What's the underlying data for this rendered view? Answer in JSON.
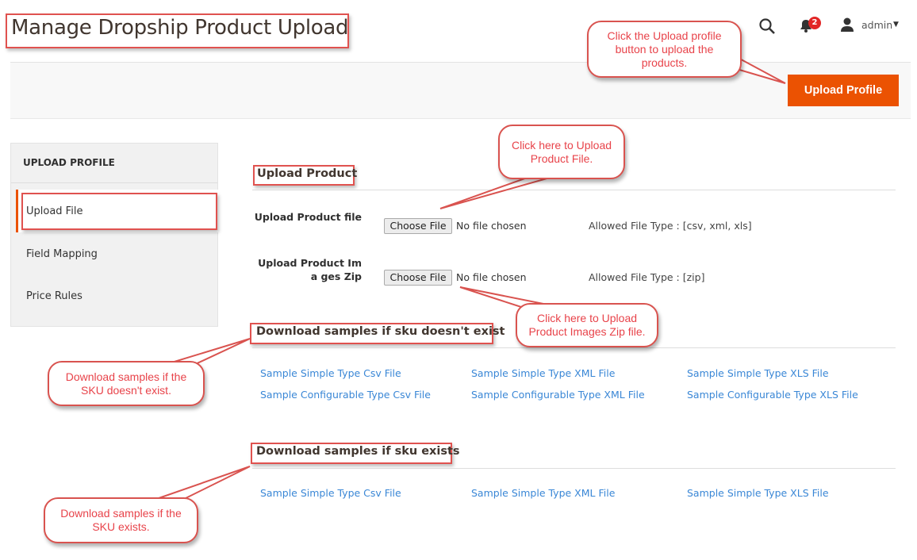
{
  "header": {
    "title": "Manage Dropship Product Upload",
    "notification_count": "2",
    "user": "admin",
    "icons": [
      "search-icon",
      "bell-icon",
      "user-icon",
      "caret-down-icon"
    ]
  },
  "toolbar": {
    "upload_profile_label": "Upload Profile",
    "accent": "#eb5202"
  },
  "sidebar": {
    "title": "UPLOAD PROFILE",
    "items": [
      {
        "label": "Upload File",
        "active": true
      },
      {
        "label": "Field Mapping"
      },
      {
        "label": "Price Rules"
      }
    ]
  },
  "upload": {
    "heading": "Upload Product",
    "rows": [
      {
        "label": "Upload Product file",
        "button": "Choose File",
        "status": "No file chosen",
        "allowed": "Allowed File Type : [csv, xml, xls]"
      },
      {
        "label": "Upload Product Ima ges Zip",
        "button": "Choose File",
        "status": "No file chosen",
        "allowed": "Allowed File Type : [zip]"
      }
    ]
  },
  "samples_not_exist": {
    "heading": "Download samples if sku doesn't exist",
    "links": [
      "Sample Simple Type Csv File",
      "Sample Simple Type XML File",
      "Sample Simple Type XLS File",
      "Sample Configurable Type Csv File",
      "Sample Configurable Type XML File",
      "Sample Configurable Type XLS File"
    ]
  },
  "samples_exist": {
    "heading": "Download samples if sku exists",
    "links": [
      "Sample Simple Type Csv File",
      "Sample Simple Type XML File",
      "Sample Simple Type XLS File"
    ]
  },
  "callouts": {
    "upload_profile": "Click the Upload profile button to upload the products.",
    "product_file": "Click here to Upload Product File.",
    "images_zip": "Click here to Upload Product Images Zip file.",
    "not_exist": "Download samples if the SKU doesn't exist.",
    "exist": "Download samples if the SKU exists."
  }
}
